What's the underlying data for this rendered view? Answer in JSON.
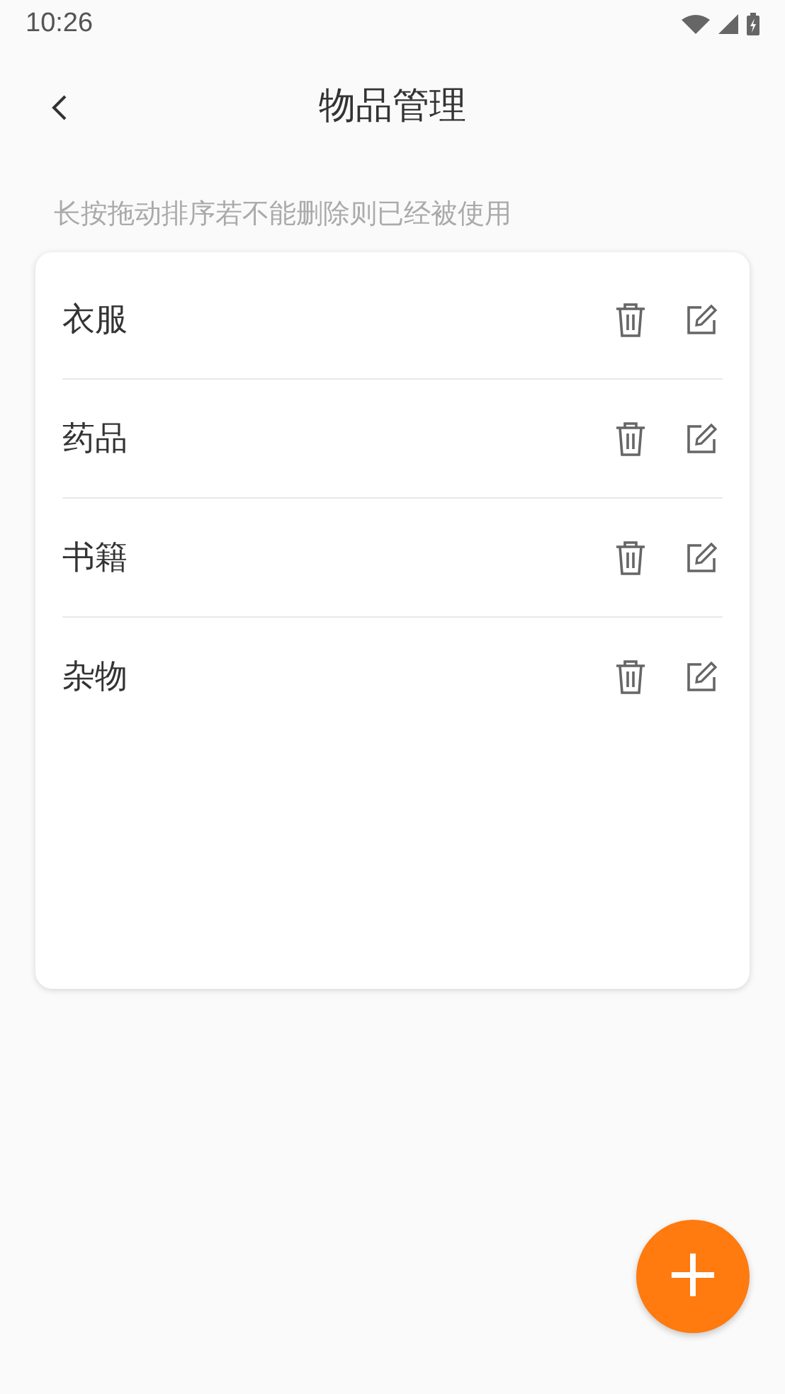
{
  "status_bar": {
    "time": "10:26"
  },
  "header": {
    "title": "物品管理"
  },
  "hint": "长按拖动排序若不能删除则已经被使用",
  "items": [
    {
      "label": "衣服"
    },
    {
      "label": "药品"
    },
    {
      "label": "书籍"
    },
    {
      "label": "杂物"
    }
  ],
  "fab": {
    "label": "+"
  }
}
